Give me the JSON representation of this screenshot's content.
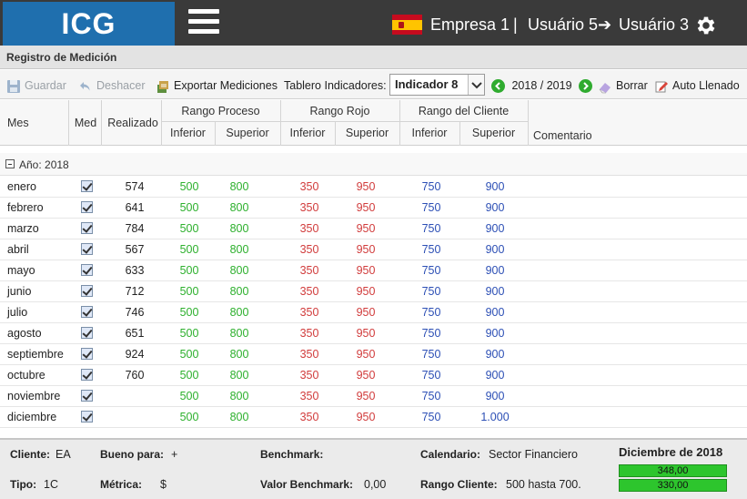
{
  "header": {
    "logo": "ICG",
    "company": "Empresa 1",
    "separator": "|",
    "user_from": "Usuário 5",
    "arrow": "➔",
    "user_to": "Usuário 3"
  },
  "page_title": "Registro de Medición",
  "toolbar": {
    "save": "Guardar",
    "undo": "Deshacer",
    "export": "Exportar Mediciones",
    "dashboard_label": "Tablero Indicadores:",
    "indicator": "Indicador 8",
    "period": "2018 / 2019",
    "clear": "Borrar",
    "autofill": "Auto Llenado"
  },
  "columns": {
    "mes": "Mes",
    "med": "Med",
    "realizado": "Realizado",
    "rango_proceso": "Rango Proceso",
    "rango_rojo": "Rango Rojo",
    "rango_cliente": "Rango del Cliente",
    "inferior": "Inferior",
    "superior": "Superior",
    "comentario": "Comentario"
  },
  "group": {
    "label": "Año: 2018"
  },
  "rows": [
    {
      "mes": "enero",
      "realizado": "574",
      "pi": "500",
      "ps": "800",
      "ri": "350",
      "rs": "950",
      "ci": "750",
      "cs": "900"
    },
    {
      "mes": "febrero",
      "realizado": "641",
      "pi": "500",
      "ps": "800",
      "ri": "350",
      "rs": "950",
      "ci": "750",
      "cs": "900"
    },
    {
      "mes": "marzo",
      "realizado": "784",
      "pi": "500",
      "ps": "800",
      "ri": "350",
      "rs": "950",
      "ci": "750",
      "cs": "900"
    },
    {
      "mes": "abril",
      "realizado": "567",
      "pi": "500",
      "ps": "800",
      "ri": "350",
      "rs": "950",
      "ci": "750",
      "cs": "900"
    },
    {
      "mes": "mayo",
      "realizado": "633",
      "pi": "500",
      "ps": "800",
      "ri": "350",
      "rs": "950",
      "ci": "750",
      "cs": "900"
    },
    {
      "mes": "junio",
      "realizado": "712",
      "pi": "500",
      "ps": "800",
      "ri": "350",
      "rs": "950",
      "ci": "750",
      "cs": "900"
    },
    {
      "mes": "julio",
      "realizado": "746",
      "pi": "500",
      "ps": "800",
      "ri": "350",
      "rs": "950",
      "ci": "750",
      "cs": "900"
    },
    {
      "mes": "agosto",
      "realizado": "651",
      "pi": "500",
      "ps": "800",
      "ri": "350",
      "rs": "950",
      "ci": "750",
      "cs": "900"
    },
    {
      "mes": "septiembre",
      "realizado": "924",
      "pi": "500",
      "ps": "800",
      "ri": "350",
      "rs": "950",
      "ci": "750",
      "cs": "900"
    },
    {
      "mes": "octubre",
      "realizado": "760",
      "pi": "500",
      "ps": "800",
      "ri": "350",
      "rs": "950",
      "ci": "750",
      "cs": "900"
    },
    {
      "mes": "noviembre",
      "realizado": "",
      "pi": "500",
      "ps": "800",
      "ri": "350",
      "rs": "950",
      "ci": "750",
      "cs": "900"
    },
    {
      "mes": "diciembre",
      "realizado": "",
      "pi": "500",
      "ps": "800",
      "ri": "350",
      "rs": "950",
      "ci": "750",
      "cs": "1.000"
    }
  ],
  "footer": {
    "cliente_label": "Cliente:",
    "cliente_value": "EA",
    "bueno_label": "Bueno para:",
    "bueno_value": "+",
    "benchmark_label": "Benchmark:",
    "calendario_label": "Calendario:",
    "calendario_value": "Sector Financiero",
    "tipo_label": "Tipo:",
    "tipo_value": "1C",
    "metrica_label": "Métrica:",
    "metrica_value": "$",
    "valor_benchmark_label": "Valor Benchmark:",
    "valor_benchmark_value": "0,00",
    "rango_cliente_label": "Rango Cliente:",
    "rango_cliente_value": "500 hasta 700.",
    "period": "Diciembre de 2018",
    "value1": "348,00",
    "value2": "330,00"
  },
  "colors": {
    "logo_bg": "#1f6fae",
    "header_bg": "#3a3a3a",
    "green": "#2db02d",
    "red": "#d13c3c",
    "blue": "#2c4fb5"
  },
  "icons": {
    "menu": "hamburger-menu-icon",
    "flag": "spain-flag-icon",
    "settings": "gear-icon",
    "save": "floppy-disk-icon",
    "undo": "undo-icon",
    "export": "export-icon",
    "prev": "arrow-left-circle-icon",
    "next": "arrow-right-circle-icon",
    "clear": "eraser-icon",
    "autofill": "pencil-icon"
  }
}
